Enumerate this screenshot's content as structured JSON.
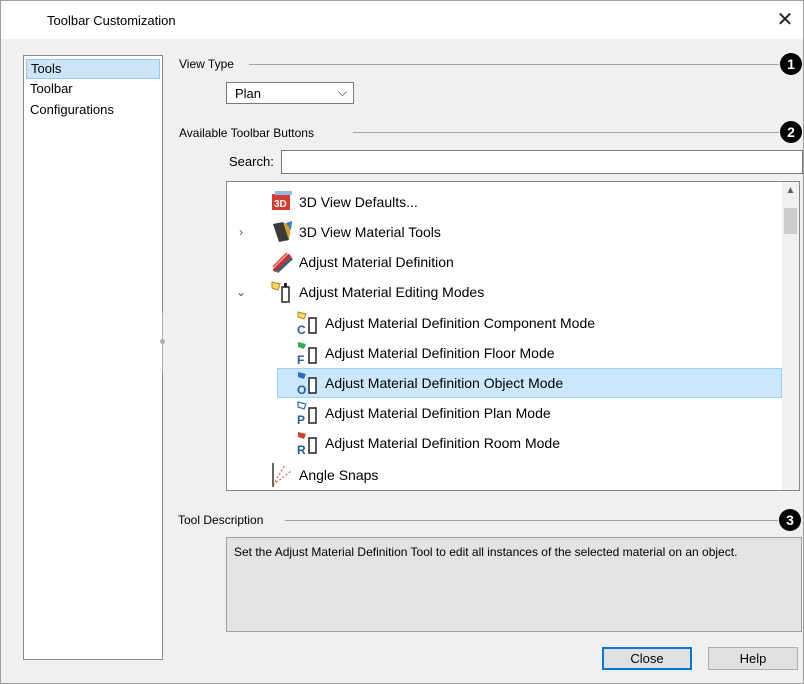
{
  "window": {
    "title": "Toolbar Customization"
  },
  "nav": {
    "items": [
      {
        "label": "Tools"
      },
      {
        "label": "Toolbar"
      },
      {
        "label": "Configurations"
      }
    ]
  },
  "view_type": {
    "label": "View Type",
    "selected": "Plan",
    "callout": "1"
  },
  "available": {
    "label": "Available Toolbar Buttons",
    "callout": "2",
    "search_label": "Search:",
    "search_value": ""
  },
  "tree": {
    "rows": [
      {
        "label": "3D View Defaults...",
        "icon": "3d-view-defaults-icon",
        "expander": ""
      },
      {
        "label": "3D View Material Tools",
        "icon": "material-tools-icon",
        "expander": "›"
      },
      {
        "label": "Adjust Material Definition",
        "icon": "adjust-material-icon",
        "expander": ""
      },
      {
        "label": "Adjust Material Editing Modes",
        "icon": "editing-modes-icon",
        "expander": "⌄"
      },
      {
        "label": "Adjust Material Definition Component Mode",
        "icon": "component-mode-icon",
        "expander": ""
      },
      {
        "label": "Adjust Material Definition Floor Mode",
        "icon": "floor-mode-icon",
        "expander": ""
      },
      {
        "label": "Adjust Material Definition Object Mode",
        "icon": "object-mode-icon",
        "expander": ""
      },
      {
        "label": "Adjust Material Definition Plan Mode",
        "icon": "plan-mode-icon",
        "expander": ""
      },
      {
        "label": "Adjust Material Definition Room Mode",
        "icon": "room-mode-icon",
        "expander": ""
      },
      {
        "label": "Angle Snaps",
        "icon": "angle-snaps-icon",
        "expander": ""
      }
    ]
  },
  "description": {
    "label": "Tool Description",
    "callout": "3",
    "text": "Set the Adjust Material Definition Tool to edit all instances of the selected material on an object."
  },
  "buttons": {
    "close": "Close",
    "help": "Help"
  },
  "colors": {
    "selection": "#cce8ff",
    "accent": "#0078d7"
  }
}
